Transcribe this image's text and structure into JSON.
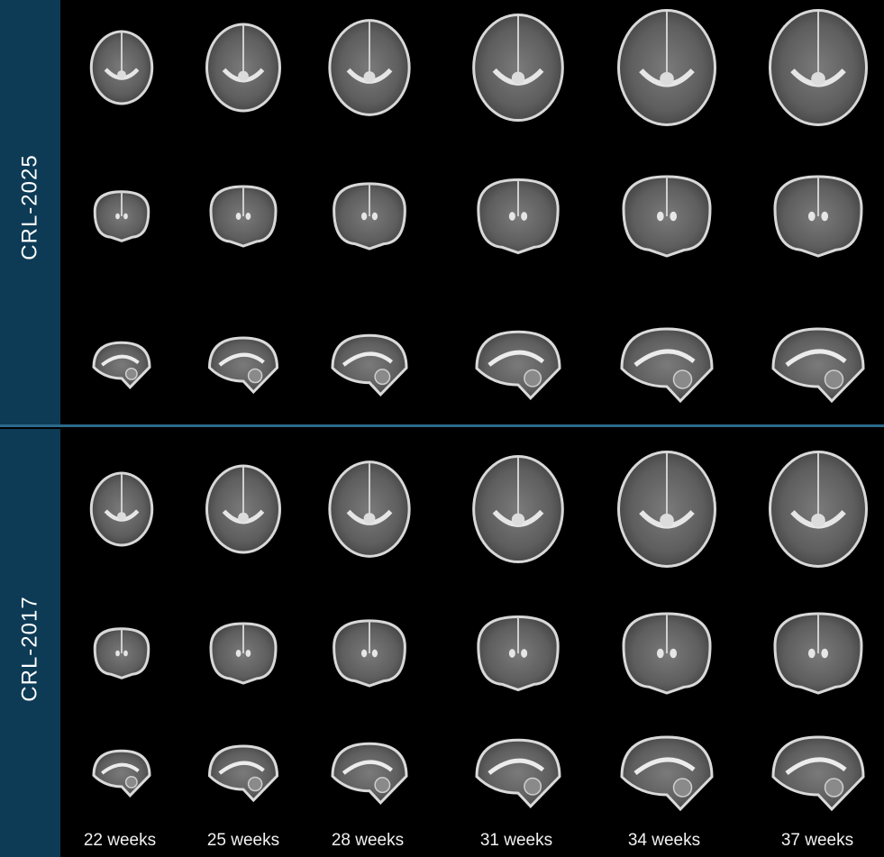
{
  "panels": [
    {
      "label": "CRL-2025"
    },
    {
      "label": "CRL-2017"
    }
  ],
  "weeks": [
    "22 weeks",
    "25 weeks",
    "28 weeks",
    "31 weeks",
    "34 weeks",
    "37 weeks"
  ],
  "views": [
    "axial",
    "coronal",
    "sagittal"
  ],
  "colors": {
    "panel_bar": "#0d3b56",
    "divider": "#2c6a8c",
    "background": "#000000"
  }
}
